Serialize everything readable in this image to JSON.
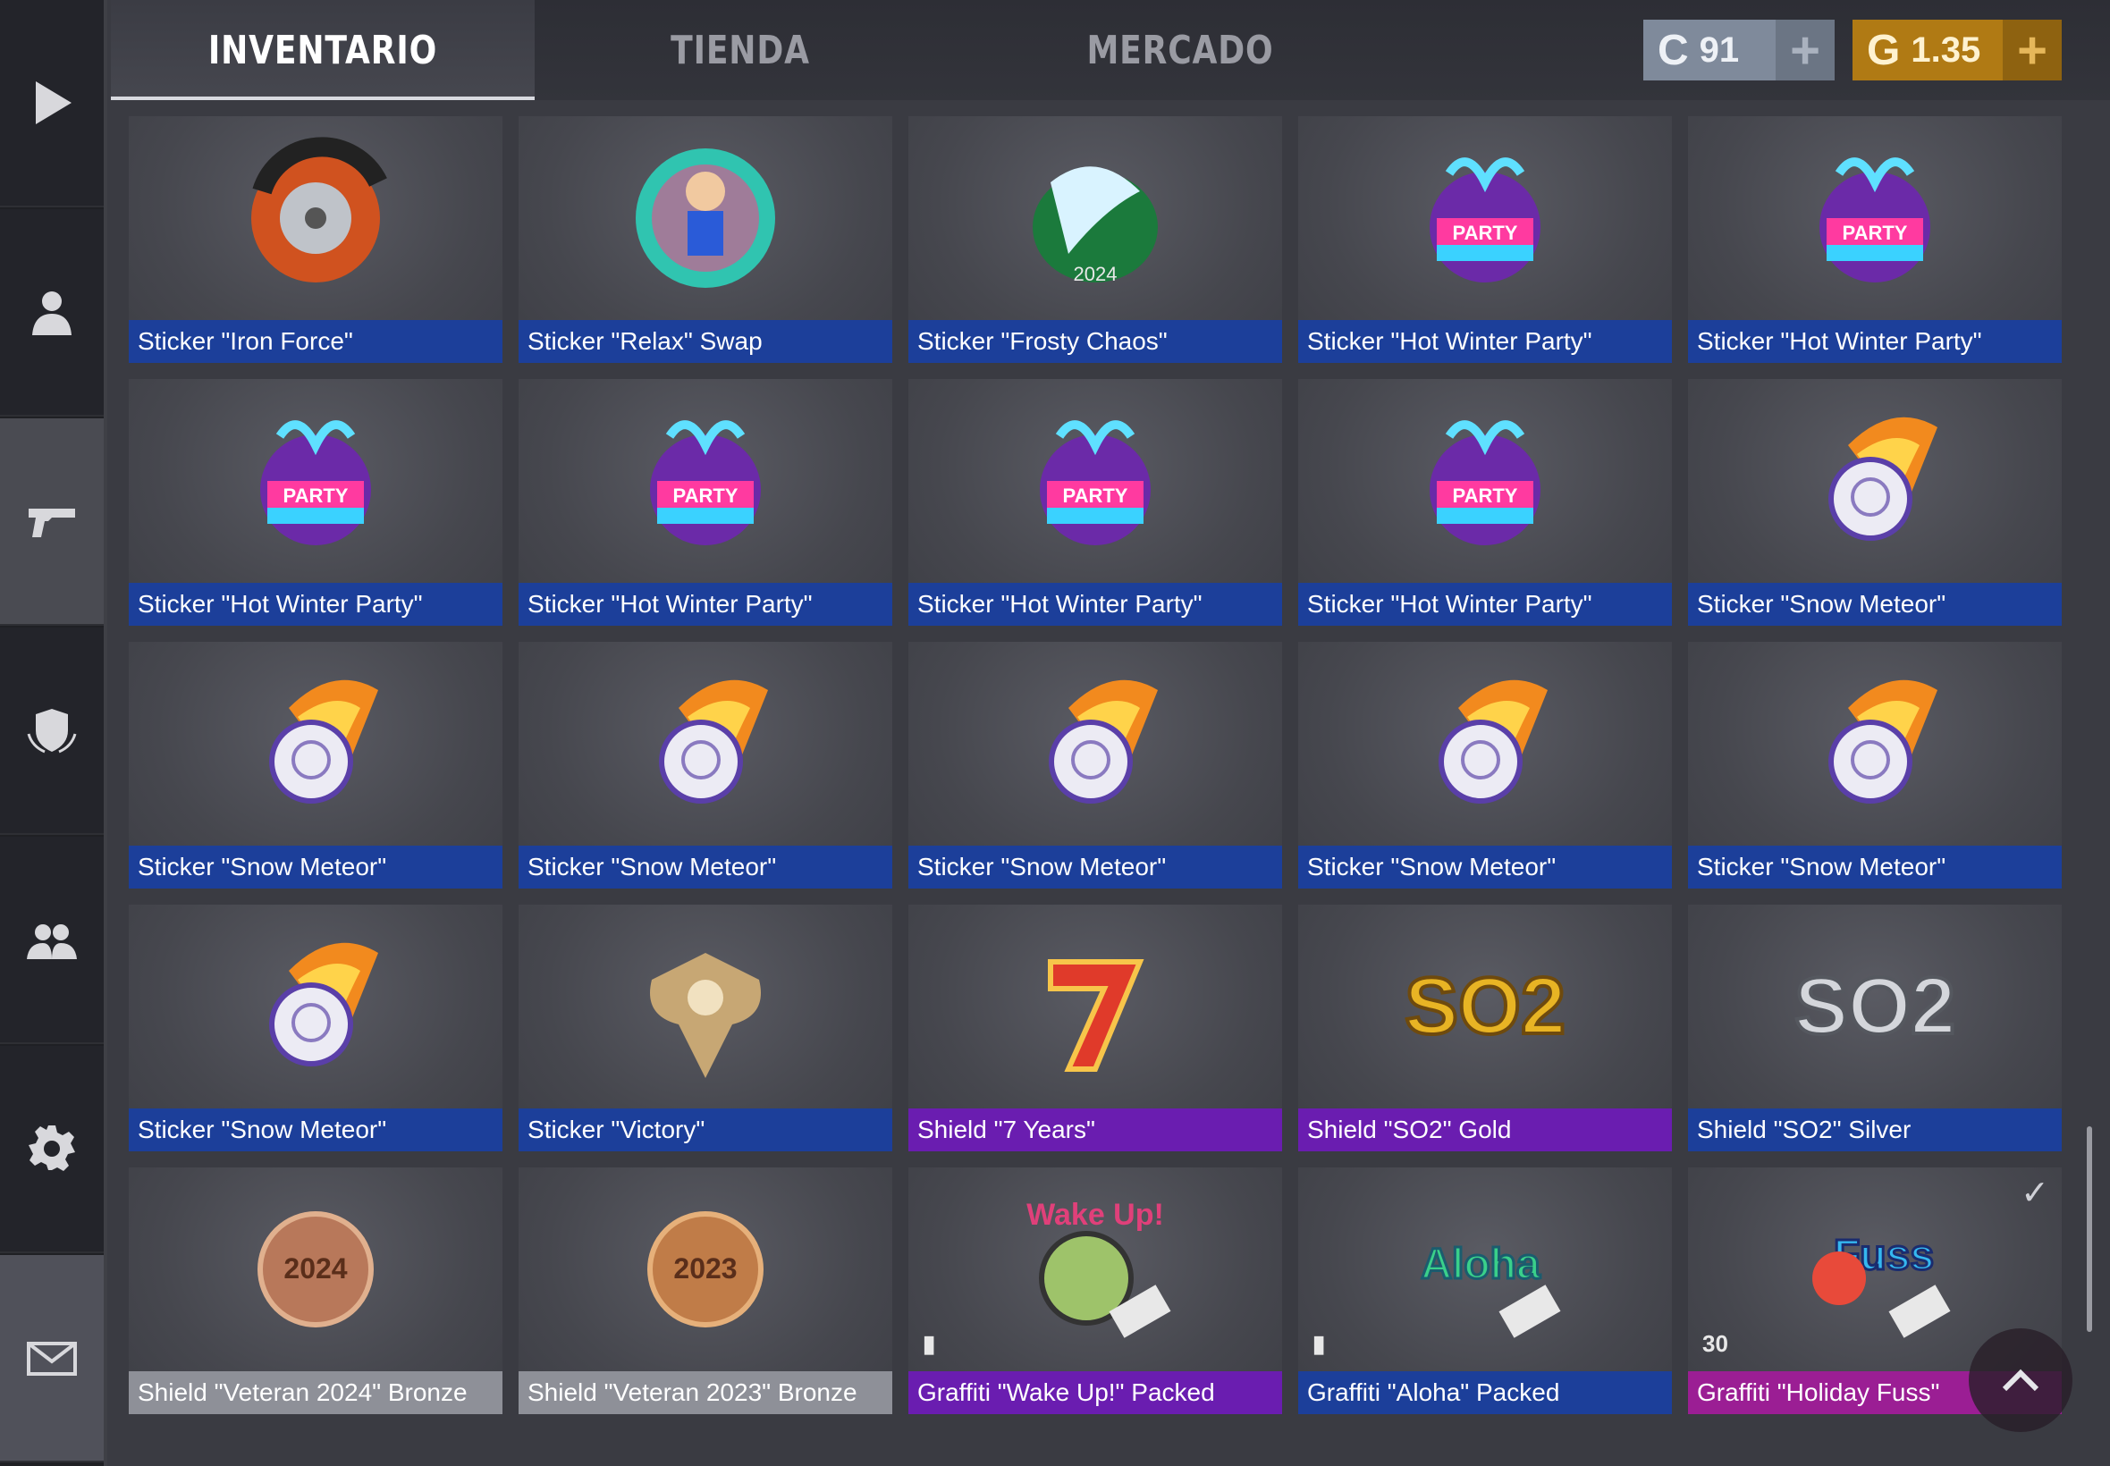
{
  "sidebar": {
    "items": [
      {
        "name": "play-icon"
      },
      {
        "name": "profile-icon"
      },
      {
        "name": "pistol-icon"
      },
      {
        "name": "shield-icon"
      },
      {
        "name": "friends-icon"
      },
      {
        "name": "gear-icon"
      },
      {
        "name": "mail-icon"
      }
    ]
  },
  "tabs": [
    {
      "label": "INVENTARIO",
      "active": true
    },
    {
      "label": "TIENDA"
    },
    {
      "label": "MERCADO"
    }
  ],
  "currency": {
    "silver": {
      "icon": "C",
      "value": "91",
      "plus": "+"
    },
    "gold": {
      "icon": "G",
      "value": "1.35",
      "plus": "+"
    }
  },
  "items": [
    {
      "label": "Sticker \"Iron Force\"",
      "rarity": "blue",
      "art": "iron-force"
    },
    {
      "label": "Sticker \"Relax\" Swap",
      "rarity": "blue",
      "art": "relax"
    },
    {
      "label": "Sticker \"Frosty Chaos\"",
      "rarity": "blue",
      "art": "frosty"
    },
    {
      "label": "Sticker \"Hot Winter Party\"",
      "rarity": "blue",
      "art": "party"
    },
    {
      "label": "Sticker \"Hot Winter Party\"",
      "rarity": "blue",
      "art": "party"
    },
    {
      "label": "Sticker \"Hot Winter Party\"",
      "rarity": "blue",
      "art": "party"
    },
    {
      "label": "Sticker \"Hot Winter Party\"",
      "rarity": "blue",
      "art": "party"
    },
    {
      "label": "Sticker \"Hot Winter Party\"",
      "rarity": "blue",
      "art": "party"
    },
    {
      "label": "Sticker \"Hot Winter Party\"",
      "rarity": "blue",
      "art": "party"
    },
    {
      "label": "Sticker \"Snow Meteor\"",
      "rarity": "blue",
      "art": "meteor"
    },
    {
      "label": "Sticker \"Snow Meteor\"",
      "rarity": "blue",
      "art": "meteor"
    },
    {
      "label": "Sticker \"Snow Meteor\"",
      "rarity": "blue",
      "art": "meteor"
    },
    {
      "label": "Sticker \"Snow Meteor\"",
      "rarity": "blue",
      "art": "meteor"
    },
    {
      "label": "Sticker \"Snow Meteor\"",
      "rarity": "blue",
      "art": "meteor"
    },
    {
      "label": "Sticker \"Snow Meteor\"",
      "rarity": "blue",
      "art": "meteor"
    },
    {
      "label": "Sticker \"Snow Meteor\"",
      "rarity": "blue",
      "art": "meteor"
    },
    {
      "label": "Sticker \"Victory\"",
      "rarity": "blue",
      "art": "victory"
    },
    {
      "label": "Shield \"7 Years\"",
      "rarity": "purple",
      "art": "seven"
    },
    {
      "label": "Shield \"SO2\" Gold",
      "rarity": "purple",
      "art": "so2-gold"
    },
    {
      "label": "Shield \"SO2\" Silver",
      "rarity": "blue",
      "art": "so2-silver"
    },
    {
      "label": "Shield \"Veteran 2024\" Bronze",
      "rarity": "gray",
      "art": "vet2024"
    },
    {
      "label": "Shield \"Veteran 2023\" Bronze",
      "rarity": "gray",
      "art": "vet2023"
    },
    {
      "label": "Graffiti \"Wake Up!\" Packed",
      "rarity": "purple",
      "art": "wakeup",
      "badge": "▮"
    },
    {
      "label": "Graffiti \"Aloha\" Packed",
      "rarity": "blue",
      "art": "aloha",
      "badge": "▮"
    },
    {
      "label": "Graffiti \"Holiday Fuss\"",
      "rarity": "pink",
      "art": "fuss",
      "badge": "30",
      "checked": true
    }
  ],
  "colors": {
    "blue": "#1c3f9a",
    "purple": "#6a1db0",
    "gray": "#8e9098",
    "pink": "#9b1e94"
  }
}
